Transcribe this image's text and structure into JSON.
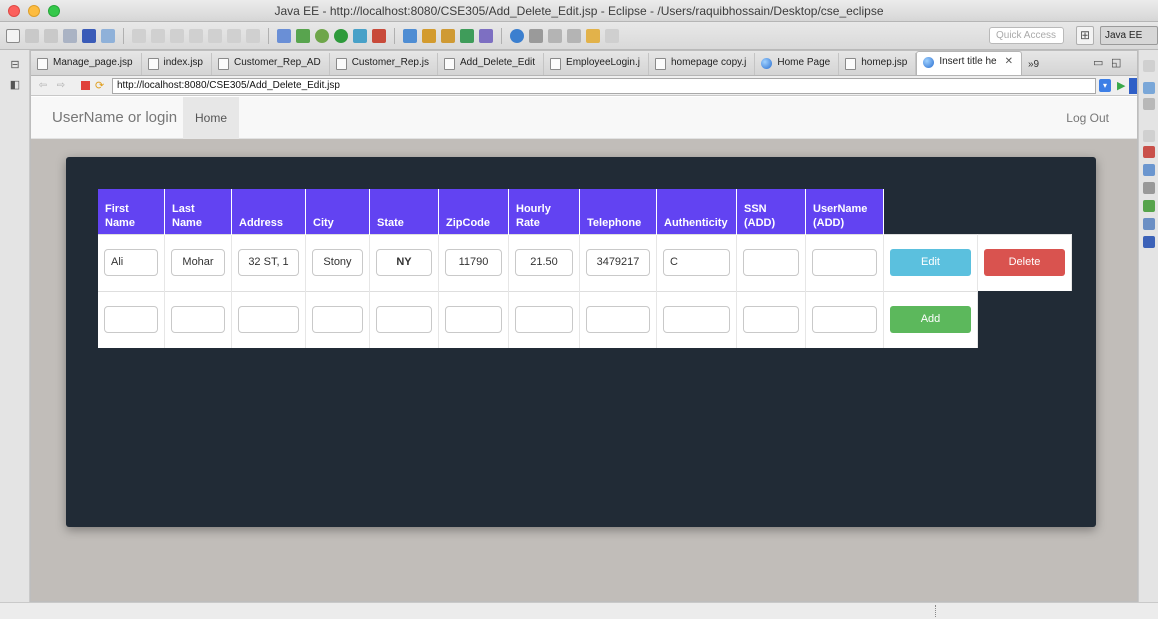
{
  "window": {
    "title": "Java EE - http://localhost:8080/CSE305/Add_Delete_Edit.jsp - Eclipse - /Users/raquibhossain/Desktop/cse_eclipse"
  },
  "toolbar": {
    "quick_access_placeholder": "Quick Access",
    "perspective_label": "Java EE"
  },
  "editor_tabs": [
    {
      "label": "Manage_page.jsp",
      "icon": "file-icon"
    },
    {
      "label": "index.jsp",
      "icon": "file-icon"
    },
    {
      "label": "Customer_Rep_AD",
      "icon": "file-icon"
    },
    {
      "label": "Customer_Rep.js",
      "icon": "file-icon"
    },
    {
      "label": "Add_Delete_Edit",
      "icon": "file-icon"
    },
    {
      "label": "EmployeeLogin.j",
      "icon": "file-icon"
    },
    {
      "label": "homepage copy.j",
      "icon": "file-icon"
    },
    {
      "label": "Home Page",
      "icon": "globe-icon"
    },
    {
      "label": "homep.jsp",
      "icon": "file-icon"
    },
    {
      "label": "Insert title he",
      "icon": "globe-icon",
      "active": true
    }
  ],
  "tab_overflow": "»9",
  "browser": {
    "url": "http://localhost:8080/CSE305/Add_Delete_Edit.jsp"
  },
  "site_nav": {
    "brand": "UserName or login",
    "home": "Home",
    "logout": "Log Out"
  },
  "table": {
    "headers": [
      "First Name",
      "Last Name",
      "Address",
      "City",
      "State",
      "ZipCode",
      "Hourly Rate",
      "Telephone",
      "Authenticity",
      "SSN (ADD)",
      "UserName (ADD)"
    ],
    "rows": [
      {
        "values": [
          "Ali",
          "Mohar",
          "32 ST, 1",
          "Stony",
          "NY",
          "11790",
          "21.50",
          "3479217",
          "C",
          "",
          ""
        ],
        "actions": [
          "Edit",
          "Delete"
        ]
      },
      {
        "values": [
          "",
          "",
          "",
          "",
          "",
          "",
          "",
          "",
          "",
          "",
          ""
        ],
        "actions": [
          "Add"
        ]
      }
    ]
  },
  "colors": {
    "header_bg": "#6243f2",
    "panel_bg": "#212b36",
    "edit": "#5bc0de",
    "delete": "#d9534f",
    "add": "#5cb85c"
  }
}
